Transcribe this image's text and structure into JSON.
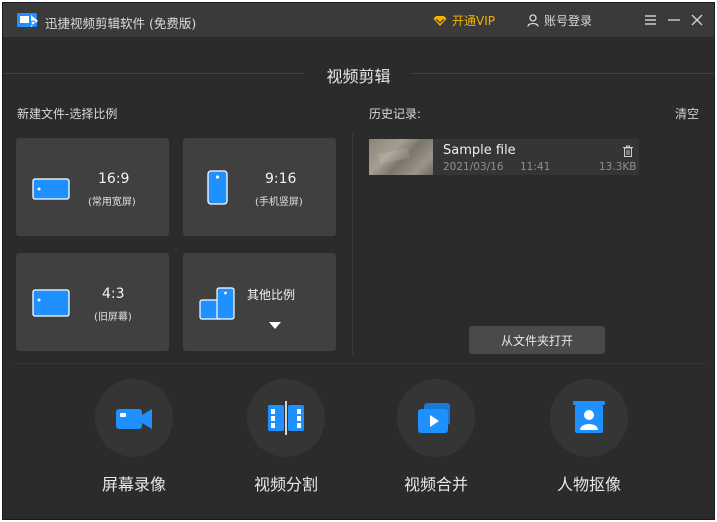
{
  "app": {
    "title": "迅捷视频剪辑软件 (免费版)",
    "vip_label": "开通VIP",
    "login_label": "账号登录"
  },
  "colors": {
    "window_bg": "#2b2b2b",
    "titlebar_bg": "#3a3a3a",
    "tile_bg": "#404040",
    "accent_blue": "#1e90ff",
    "vip_gold": "#f0b400"
  },
  "section": {
    "title": "视频剪辑"
  },
  "ratios": {
    "heading": "新建文件-选择比例",
    "items": [
      {
        "main": "16:9",
        "sub": "(常用宽屏)",
        "icon": "landscape-screen-icon"
      },
      {
        "main": "9:16",
        "sub": "(手机竖屏)",
        "icon": "portrait-phone-icon"
      },
      {
        "main": "4:3",
        "sub": "(旧屏幕)",
        "icon": "old-screen-icon"
      },
      {
        "main": "其他比例",
        "sub": "",
        "icon": "other-ratio-icon"
      }
    ]
  },
  "history": {
    "heading": "历史记录:",
    "clear_label": "清空",
    "items": [
      {
        "name": "Sample file",
        "date": "2021/03/16",
        "time": "11:41",
        "size": "13.3KB"
      }
    ],
    "open_folder_label": "从文件夹打开"
  },
  "tools": [
    {
      "label": "屏幕录像",
      "icon": "video-camera-icon"
    },
    {
      "label": "视频分割",
      "icon": "film-split-icon"
    },
    {
      "label": "视频合并",
      "icon": "video-merge-icon"
    },
    {
      "label": "人物抠像",
      "icon": "portrait-cutout-icon"
    }
  ]
}
